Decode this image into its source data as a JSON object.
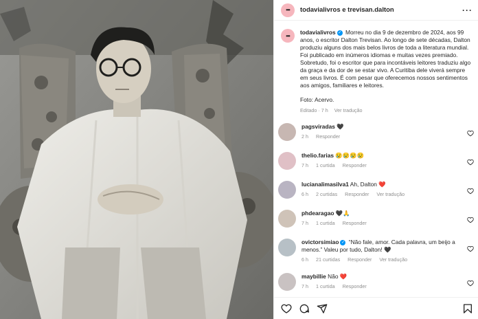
{
  "header": {
    "title": "todavialivros e trevisan.dalton"
  },
  "post": {
    "user": "todavialivros",
    "caption": "Morreu no dia 9 de dezembro de 2024, aos 99 anos, o escritor Dalton Trevisan. Ao longo de sete décadas, Dalton produziu alguns dos mais belos livros de toda a literatura mundial. Foi publicado em inúmeros idiomas e muitas vezes premiado. Sobretudo, foi o escritor que para incontáveis leitores traduziu algo da graça e da dor de se estar vivo. A Curitiba dele viverá sempre em seus livros. É com pesar que oferecemos nossos sentimentos aos amigos, familiares e leitores.",
    "photo_credit": "Foto: Acervo.",
    "meta_edited": "Editado · 7 h",
    "meta_translation": "Ver tradução"
  },
  "comments": [
    {
      "user": "pagsviradas",
      "text": "🖤",
      "time": "2 h",
      "likes": "",
      "reply": "Responder",
      "translate": ""
    },
    {
      "user": "thelio.farias",
      "text": "😢😢😢😢",
      "time": "7 h",
      "likes": "1 curtida",
      "reply": "Responder",
      "translate": ""
    },
    {
      "user": "lucianalimasilva1",
      "text": "Ah, Dalton ❤️",
      "time": "6 h",
      "likes": "2 curtidas",
      "reply": "Responder",
      "translate": "Ver tradução"
    },
    {
      "user": "phdearagao",
      "text": "🖤🙏",
      "time": "7 h",
      "likes": "1 curtida",
      "reply": "Responder",
      "translate": ""
    },
    {
      "user": "ovictorsimiao",
      "text": "“Não fale, amor. Cada palavra, um beijo a menos.” Valeu por tudo, Dalton! 🖤",
      "time": "6 h",
      "likes": "21 curtidas",
      "reply": "Responder",
      "translate": "Ver tradução"
    },
    {
      "user": "maybillie",
      "text": "Não ❤️",
      "time": "7 h",
      "likes": "1 curtida",
      "reply": "Responder",
      "translate": ""
    }
  ],
  "icons": {
    "like": "heart-icon",
    "comment": "comment-icon",
    "share": "share-icon",
    "save": "bookmark-icon",
    "more": "more-options-icon"
  },
  "colors": {
    "avatar_brand": "#f6b6bd",
    "verified": "#0095f6",
    "secondary_text": "#8e8e8e"
  }
}
